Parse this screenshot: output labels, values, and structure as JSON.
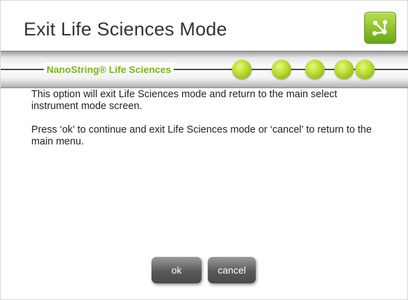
{
  "dialog": {
    "title": "Exit Life Sciences Mode",
    "app_icon": "network-icon"
  },
  "banner": {
    "brand": "NanoString® Life Sciences",
    "dots": 5,
    "accent_color": "#a6cf2a"
  },
  "message": {
    "paragraph_1": "This option will exit Life Sciences mode and return to the main select instrument mode screen.",
    "paragraph_2": "Press ‘ok’ to continue and exit Life Sciences mode or ‘cancel’ to return to the main menu."
  },
  "buttons": {
    "ok_label": "ok",
    "cancel_label": "cancel"
  }
}
